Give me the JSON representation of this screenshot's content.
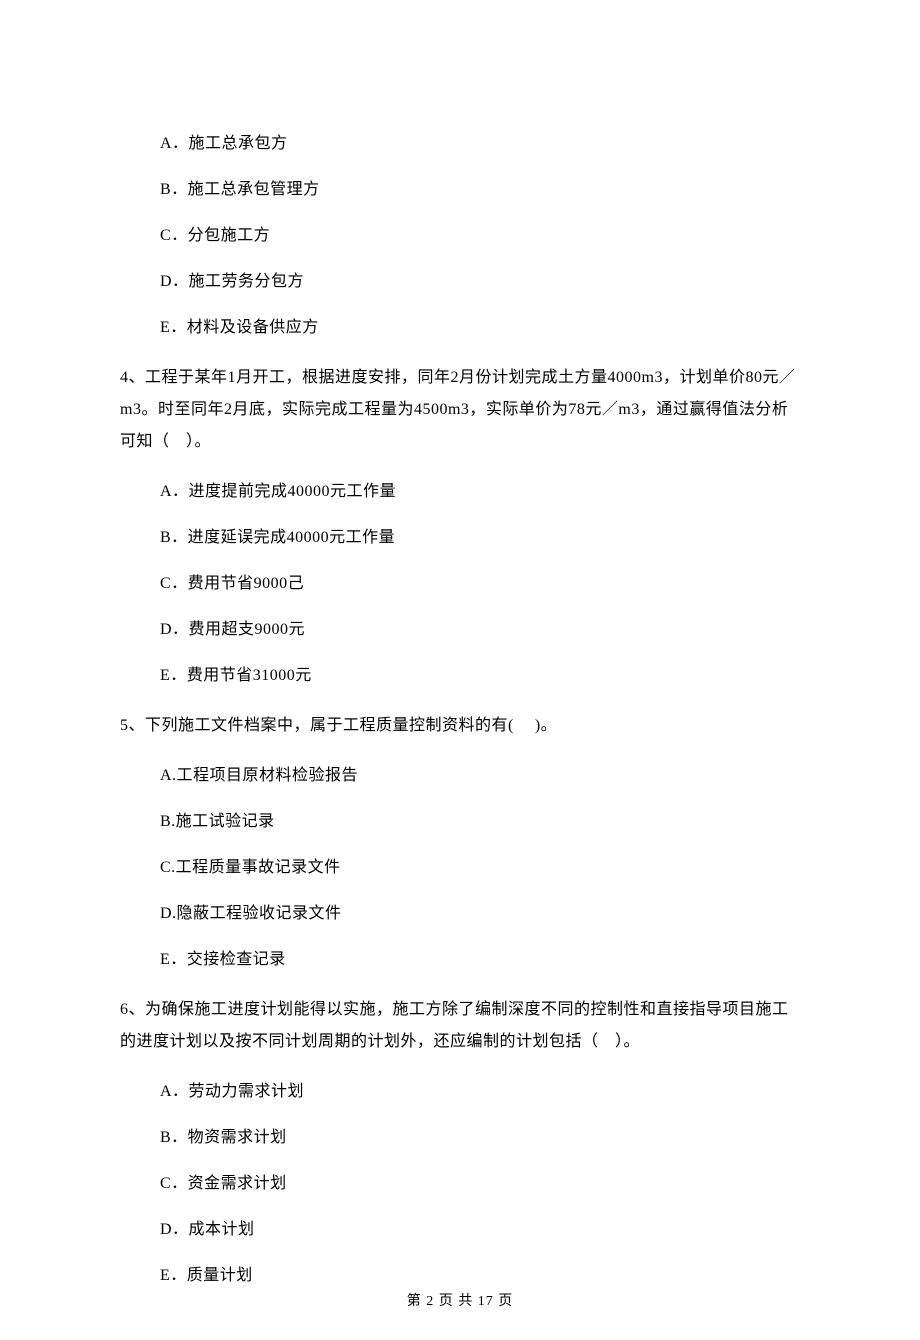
{
  "q3": {
    "options": {
      "A": "A．施工总承包方",
      "B": "B．施工总承包管理方",
      "C": "C．分包施工方",
      "D": "D．施工劳务分包方",
      "E": "E．材料及设备供应方"
    }
  },
  "q4": {
    "text": "4、工程于某年1月开工，根据进度安排，同年2月份计划完成土方量4000m3，计划单价80元／m3。时至同年2月底，实际完成工程量为4500m3，实际单价为78元／m3，通过赢得值法分析可知（　）。",
    "options": {
      "A": "A．进度提前完成40000元工作量",
      "B": "B．进度延误完成40000元工作量",
      "C": "C．费用节省9000己",
      "D": "D．费用超支9000元",
      "E": "E．费用节省31000元"
    }
  },
  "q5": {
    "text": "5、下列施工文件档案中，属于工程质量控制资料的有(　 )。",
    "options": {
      "A": "A.工程项目原材料检验报告",
      "B": "B.施工试验记录",
      "C": "C.工程质量事故记录文件",
      "D": "D.隐蔽工程验收记录文件",
      "E": "E．交接检查记录"
    }
  },
  "q6": {
    "text": "6、为确保施工进度计划能得以实施，施工方除了编制深度不同的控制性和直接指导项目施工的进度计划以及按不同计划周期的计划外，还应编制的计划包括（　）。",
    "options": {
      "A": "A．劳动力需求计划",
      "B": "B．物资需求计划",
      "C": "C．资金需求计划",
      "D": "D．成本计划",
      "E": "E．质量计划"
    }
  },
  "footer": "第 2 页 共 17 页"
}
